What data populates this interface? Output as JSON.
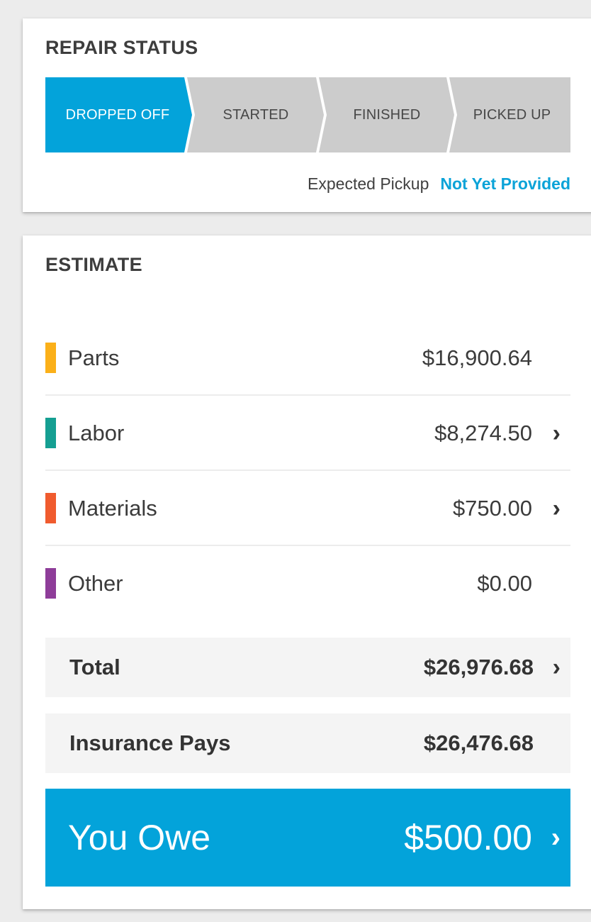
{
  "repair_status": {
    "title": "REPAIR STATUS",
    "steps": [
      {
        "label": "DROPPED OFF",
        "active": true
      },
      {
        "label": "STARTED",
        "active": false
      },
      {
        "label": "FINISHED",
        "active": false
      },
      {
        "label": "PICKED UP",
        "active": false
      }
    ],
    "expected_pickup_label": "Expected Pickup",
    "expected_pickup_value": "Not Yet Provided"
  },
  "estimate": {
    "title": "ESTIMATE",
    "items": [
      {
        "label": "Parts",
        "amount": "$16,900.64",
        "color": "#fbb019",
        "has_chevron": false
      },
      {
        "label": "Labor",
        "amount": "$8,274.50",
        "color": "#159f92",
        "has_chevron": true
      },
      {
        "label": "Materials",
        "amount": "$750.00",
        "color": "#f05b2e",
        "has_chevron": true
      },
      {
        "label": "Other",
        "amount": "$0.00",
        "color": "#8e3d99",
        "has_chevron": false
      }
    ],
    "total": {
      "label": "Total",
      "amount": "$26,976.68",
      "has_chevron": true
    },
    "insurance": {
      "label": "Insurance Pays",
      "amount": "$26,476.68",
      "has_chevron": false
    },
    "you_owe": {
      "label": "You Owe",
      "amount": "$500.00",
      "has_chevron": true
    }
  },
  "icons": {
    "chevron": "chevron-right-icon",
    "chevron_glyph": "›"
  },
  "colors": {
    "accent": "#03a3da",
    "step_inactive": "#cccccc",
    "pickup_value": "#0ba3d8"
  }
}
